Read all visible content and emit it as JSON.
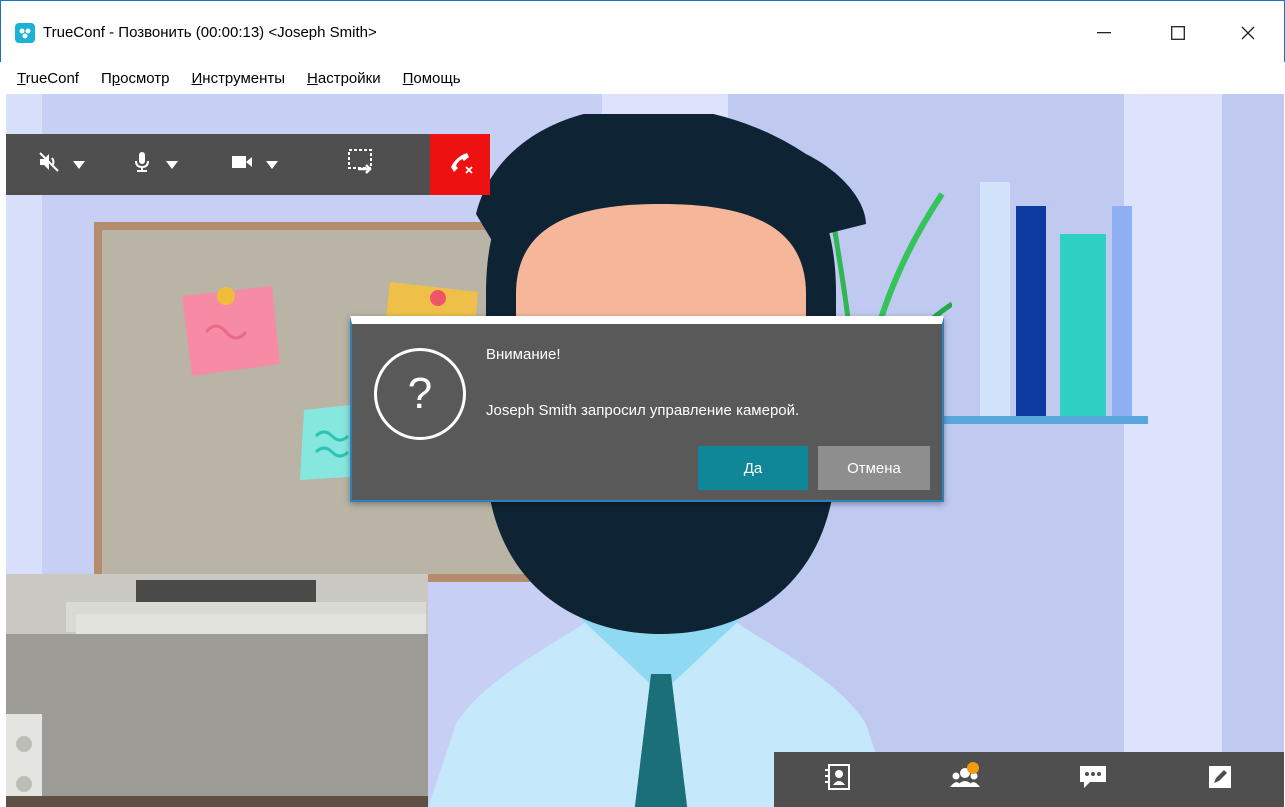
{
  "window": {
    "title": "TrueConf - Позвонить (00:00:13) <Joseph Smith>",
    "minimize_glyph": "—",
    "maximize_glyph": "☐",
    "close_glyph": "✕"
  },
  "menu": {
    "items": [
      {
        "label": "TrueConf",
        "accel": "T"
      },
      {
        "label": "Просмотр",
        "accel": "р"
      },
      {
        "label": "Инструменты",
        "accel": "И"
      },
      {
        "label": "Настройки",
        "accel": "Н"
      },
      {
        "label": "Помощь",
        "accel": "П"
      }
    ]
  },
  "toolbar": {
    "icons": [
      "speaker-muted-icon",
      "microphone-icon",
      "camera-icon",
      "screen-share-icon",
      "hangup-icon"
    ]
  },
  "dialog": {
    "title": "Внимание!",
    "message": "Joseph Smith запросил управление камерой.",
    "icon": "?",
    "yes_label": "Да",
    "cancel_label": "Отмена"
  },
  "bottom_panel": {
    "icons": [
      "contacts-icon",
      "participants-icon",
      "chat-icon",
      "edit-icon"
    ],
    "participants_badge_color": "#f39c12"
  },
  "colors": {
    "accent": "#0f8799",
    "hangup": "#ee1111",
    "toolbar_bg": "#4f4f4f",
    "dialog_bg": "#595959"
  }
}
